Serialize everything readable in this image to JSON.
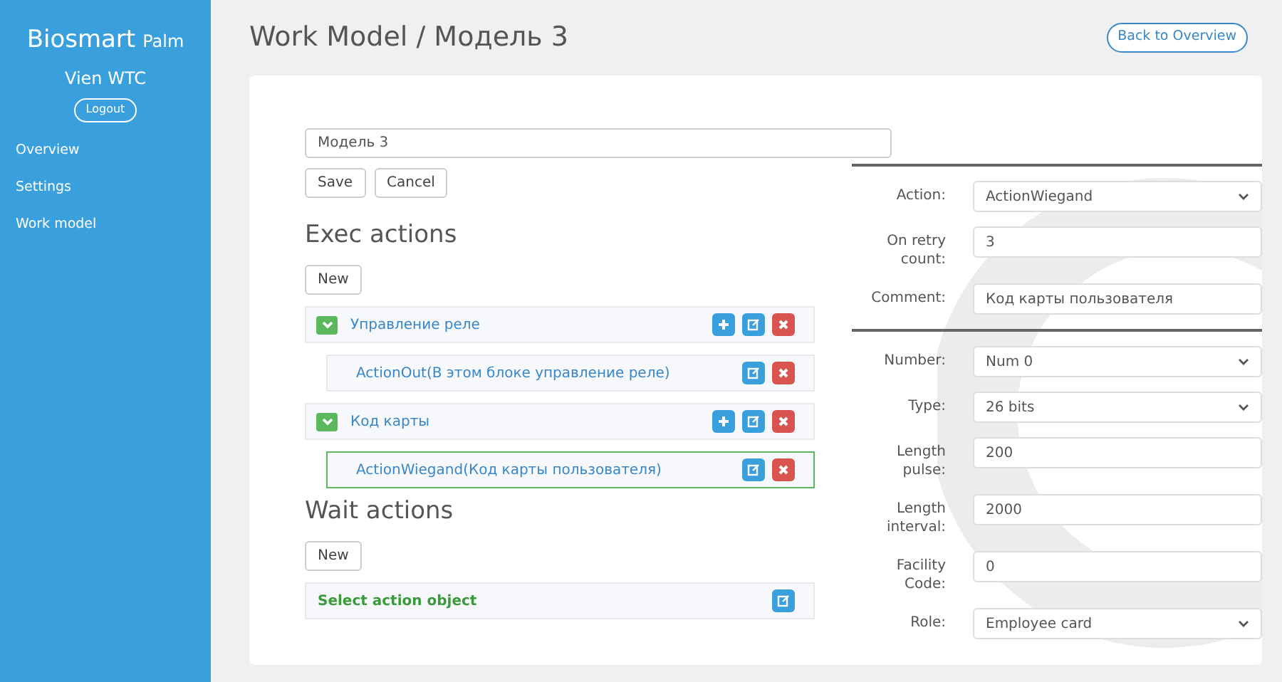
{
  "sidebar": {
    "brand": "Biosmart",
    "brand_sub": "Palm",
    "site": "Vien WTC",
    "logout": "Logout",
    "items": [
      {
        "label": "Overview"
      },
      {
        "label": "Settings"
      },
      {
        "label": "Work model"
      }
    ]
  },
  "header": {
    "title": "Work Model / Модель 3",
    "back_button": "Back to Overview"
  },
  "name_field": {
    "value": "Модель 3"
  },
  "form_buttons": [
    "Save",
    "Cancel"
  ],
  "exec_actions": {
    "heading": "Exec actions",
    "new_button": "New",
    "items": [
      {
        "kind": "group",
        "label": "Управление реле",
        "expanded": true,
        "children": [
          {
            "label": "ActionOut(В этом блоке управление реле)",
            "selected": false
          }
        ]
      },
      {
        "kind": "group",
        "label": "Код карты",
        "expanded": true,
        "children": [
          {
            "label": "ActionWiegand(Код карты пользователя)",
            "selected": true
          }
        ]
      }
    ]
  },
  "wait_actions": {
    "heading": "Wait actions",
    "new_button": "New",
    "items": [
      {
        "kind": "empty",
        "label": "Select action object"
      }
    ]
  },
  "settings_sections": [
    {
      "fields": [
        {
          "label": "Action:",
          "kind": "select",
          "value": "ActionWiegand"
        },
        {
          "label": "On retry count:",
          "kind": "input",
          "value": "3"
        },
        {
          "label": "Comment:",
          "kind": "input",
          "value": "Код карты пользователя"
        }
      ]
    },
    {
      "fields": [
        {
          "label": "Number:",
          "kind": "select",
          "value": "Num 0"
        },
        {
          "label": "Type:",
          "kind": "select",
          "value": "26 bits"
        },
        {
          "label": "Length pulse:",
          "kind": "input",
          "value": "200"
        },
        {
          "label": "Length interval:",
          "kind": "input",
          "value": "2000"
        },
        {
          "label": "Facility Code:",
          "kind": "input",
          "value": "0"
        },
        {
          "label": "Role:",
          "kind": "select",
          "value": "Employee card"
        }
      ]
    }
  ]
}
